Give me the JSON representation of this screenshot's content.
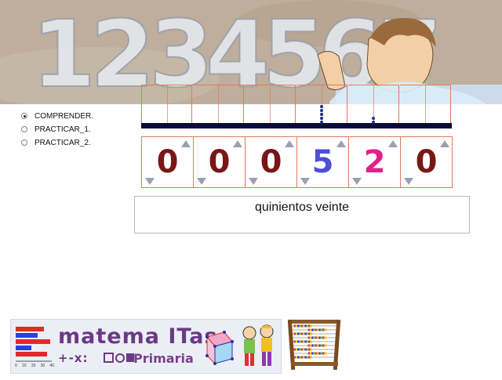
{
  "menu": {
    "options": [
      {
        "label": "COMPRENDER.",
        "selected": true
      },
      {
        "label": "PRACTICAR_1.",
        "selected": false
      },
      {
        "label": "PRACTICAR_2.",
        "selected": false
      }
    ]
  },
  "banner": {
    "digits": [
      "1",
      "2",
      "3",
      "4",
      "5",
      "6",
      "7"
    ]
  },
  "counter": {
    "digits": [
      {
        "value": "0",
        "color": "#7a1616"
      },
      {
        "value": "0",
        "color": "#7a1616"
      },
      {
        "value": "0",
        "color": "#7a1616"
      },
      {
        "value": "5",
        "color": "#4d4fd8"
      },
      {
        "value": "2",
        "color": "#e0218a"
      },
      {
        "value": "0",
        "color": "#7a1616"
      }
    ],
    "beads": [
      0,
      0,
      0,
      5,
      2,
      0
    ],
    "arrow_up_icon": "arrow-up-icon",
    "arrow_down_icon": "arrow-down-icon"
  },
  "number_text": "quinientos veinte",
  "logo": {
    "title": "matema ITas",
    "subtitle": "Primaria",
    "symbols": "+-x:",
    "ruler_ticks": [
      "0",
      "10",
      "20",
      "30",
      "40"
    ]
  },
  "colors": {
    "cell_border": "#e07a5f",
    "rod": "#0b0b3a",
    "bead": "#1b2f8c",
    "arrow": "#9aa0b4"
  }
}
